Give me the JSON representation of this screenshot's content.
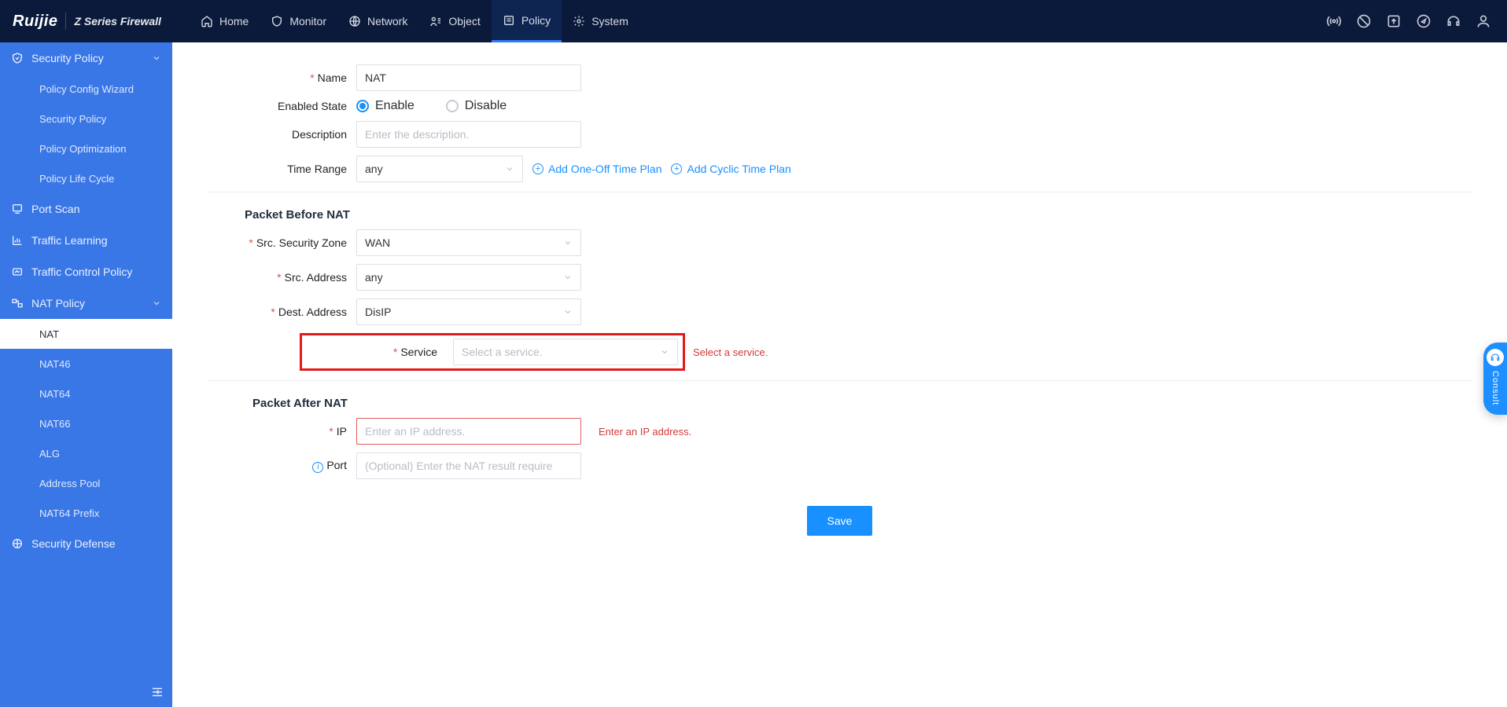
{
  "brand": {
    "logo": "Ruijie",
    "tagline": "Z Series Firewall"
  },
  "topnav": {
    "items": [
      {
        "label": "Home"
      },
      {
        "label": "Monitor"
      },
      {
        "label": "Network"
      },
      {
        "label": "Object"
      },
      {
        "label": "Policy"
      },
      {
        "label": "System"
      }
    ]
  },
  "sidebar": {
    "sections": {
      "security_policy": {
        "label": "Security Policy"
      },
      "port_scan": {
        "label": "Port Scan"
      },
      "traffic_learning": {
        "label": "Traffic Learning"
      },
      "traffic_control": {
        "label": "Traffic Control Policy"
      },
      "nat_policy": {
        "label": "NAT Policy"
      },
      "security_defense": {
        "label": "Security Defense"
      }
    },
    "security_policy_items": [
      {
        "label": "Policy Config Wizard"
      },
      {
        "label": "Security Policy"
      },
      {
        "label": "Policy Optimization"
      },
      {
        "label": "Policy Life Cycle"
      }
    ],
    "nat_items": [
      {
        "label": "NAT"
      },
      {
        "label": "NAT46"
      },
      {
        "label": "NAT64"
      },
      {
        "label": "NAT66"
      },
      {
        "label": "ALG"
      },
      {
        "label": "Address Pool"
      },
      {
        "label": "NAT64 Prefix"
      }
    ]
  },
  "form": {
    "labels": {
      "name": "Name",
      "enabled_state": "Enabled State",
      "description": "Description",
      "time_range": "Time Range",
      "src_zone": "Src. Security Zone",
      "src_addr": "Src. Address",
      "dest_addr": "Dest. Address",
      "service": "Service",
      "ip": "IP",
      "port": "Port"
    },
    "values": {
      "name": "NAT",
      "time_range": "any",
      "src_zone": "WAN",
      "src_addr": "any",
      "dest_addr": "DisIP"
    },
    "placeholders": {
      "description": "Enter the description.",
      "service": "Select a service.",
      "ip": "Enter an IP address.",
      "port": "(Optional) Enter the NAT result require"
    },
    "radios": {
      "enable": "Enable",
      "disable": "Disable"
    },
    "links": {
      "add_one_off": "Add One-Off Time Plan",
      "add_cyclic": "Add Cyclic Time Plan"
    },
    "section_before": "Packet Before NAT",
    "section_after": "Packet After NAT",
    "errors": {
      "service": "Select a service.",
      "ip": "Enter an IP address."
    },
    "save": "Save"
  },
  "consult": {
    "label": "Consult"
  }
}
